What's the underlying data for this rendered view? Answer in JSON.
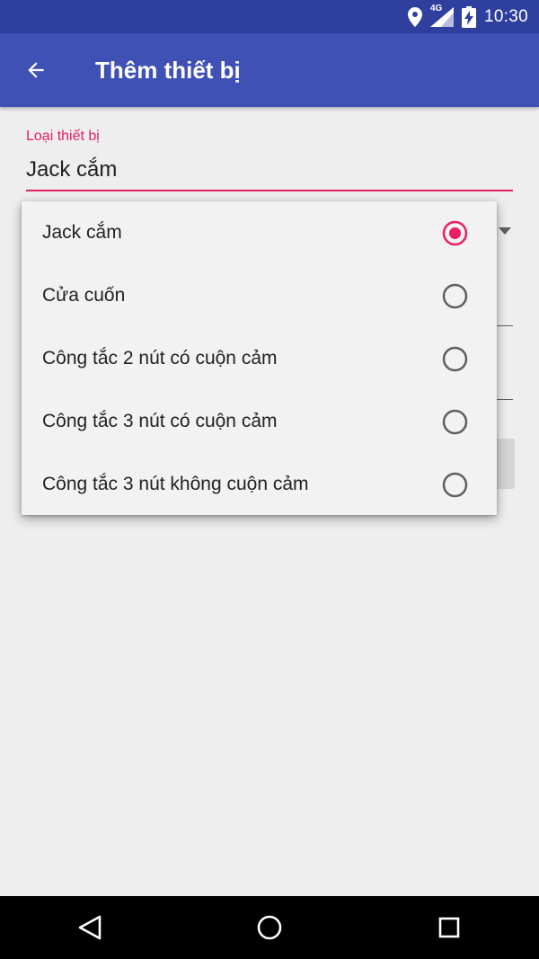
{
  "status_bar": {
    "network_label": "4G",
    "time": "10:30",
    "icons": [
      "location-icon",
      "signal-icon",
      "battery-charging-icon"
    ]
  },
  "app_bar": {
    "back_icon": "arrow-back-icon",
    "title": "Thêm thiết bị"
  },
  "form": {
    "device_type": {
      "label": "Loại thiết bị",
      "value": "Jack cắm"
    }
  },
  "dropdown": {
    "options": [
      {
        "label": "Jack cắm",
        "selected": true
      },
      {
        "label": "Cửa cuốn",
        "selected": false
      },
      {
        "label": "Công tắc 2 nút có cuộn cảm",
        "selected": false
      },
      {
        "label": "Công tắc 3 nút có cuộn cảm",
        "selected": false
      },
      {
        "label": "Công tắc 3 nút không cuộn cảm",
        "selected": false
      }
    ]
  },
  "nav_bar": {
    "icons": [
      "back-triangle-icon",
      "home-circle-icon",
      "recents-square-icon"
    ]
  },
  "colors": {
    "status_bar": "#2f3f9e",
    "app_bar": "#3f51b5",
    "accent": "#e91e63",
    "background": "#eeeeee",
    "popup": "#f2f2f2",
    "radio_unchecked": "#5f5f5f"
  }
}
